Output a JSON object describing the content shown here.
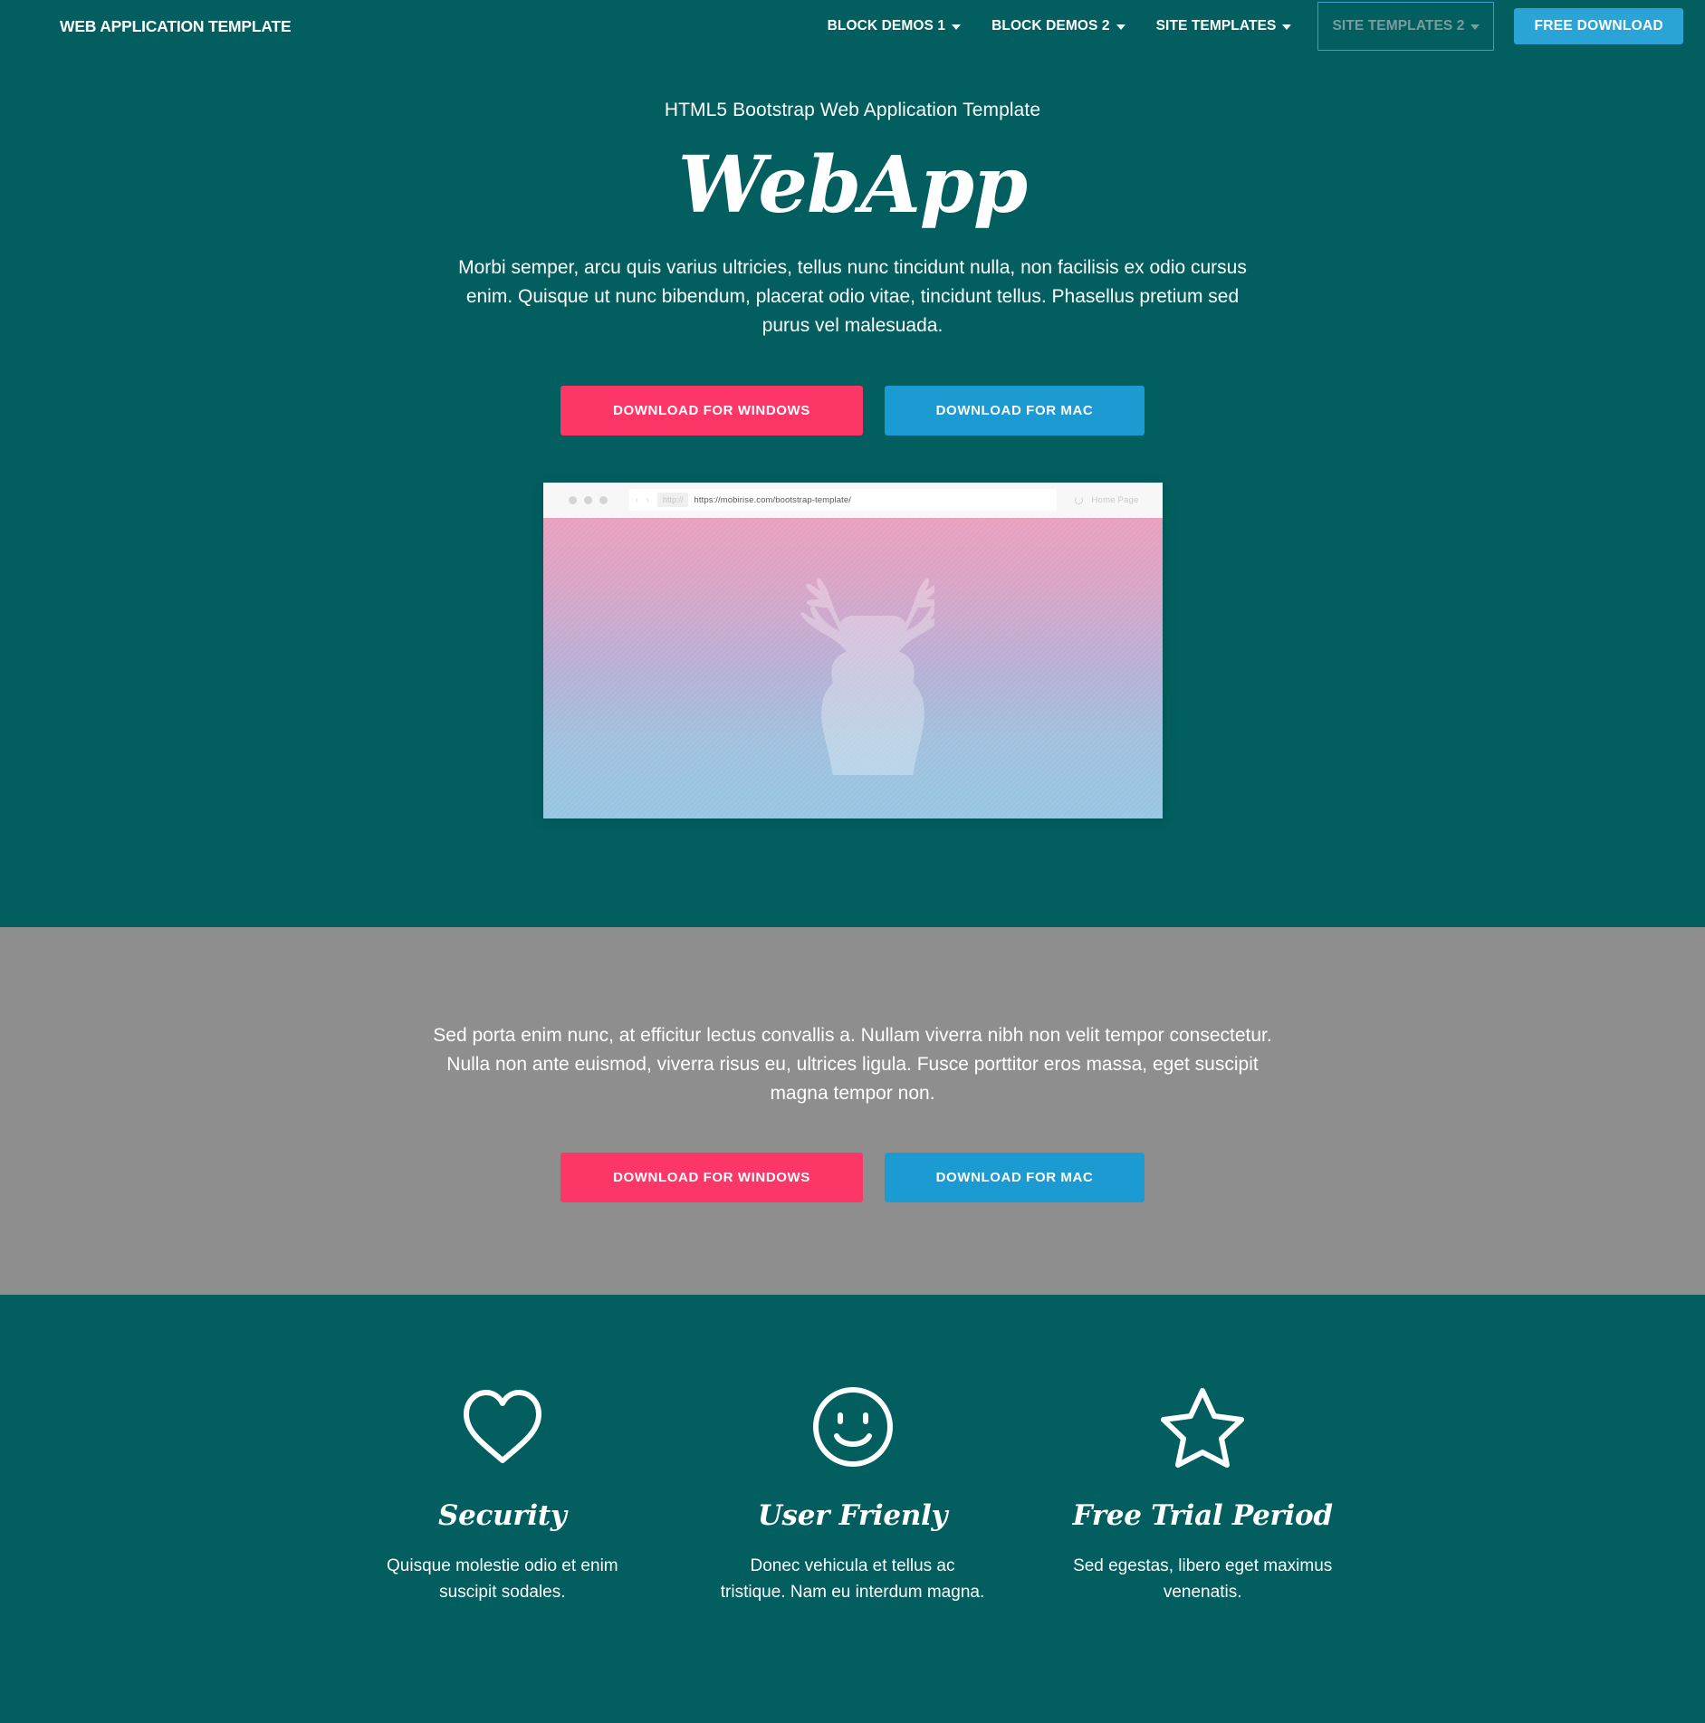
{
  "navbar": {
    "brand": "WEB APPLICATION TEMPLATE",
    "items": [
      {
        "label": "BLOCK DEMOS 1",
        "has_caret": true,
        "focused": false
      },
      {
        "label": "BLOCK DEMOS 2",
        "has_caret": true,
        "focused": false
      },
      {
        "label": "SITE TEMPLATES",
        "has_caret": true,
        "focused": false
      },
      {
        "label": "SITE TEMPLATES 2",
        "has_caret": true,
        "focused": true
      }
    ],
    "cta_label": "FREE DOWNLOAD",
    "colors": {
      "background": "#025e5f",
      "cta": "#2aa4d6",
      "focus_outline": "#3a9fd4"
    }
  },
  "hero": {
    "kicker": "HTML5 Bootstrap Web Application Template",
    "title": "WebApp",
    "paragraph": "Morbi semper, arcu quis varius ultricies, tellus nunc tincidunt nulla, non facilisis ex odio cursus enim. Quisque ut nunc bibendum, placerat odio vitae, tincidunt tellus. Phasellus pretium sed purus vel malesuada.",
    "buttons": {
      "windows": "DOWNLOAD FOR WINDOWS",
      "mac": "DOWNLOAD FOR MAC"
    },
    "colors": {
      "windows": "#fc3768",
      "mac": "#1b9bd1"
    }
  },
  "mockup": {
    "scheme_chip": "http://",
    "url": "https://mobirise.com/bootstrap-template/",
    "tab_label": "Home Page",
    "nav_arrows": "‹ ›",
    "image_subject": "deer-silhouette",
    "gradient": {
      "from": "#e8a0bd",
      "to": "#96c6e2"
    }
  },
  "gray_section": {
    "paragraph": "Sed porta enim nunc, at efficitur lectus convallis a. Nullam viverra nibh non velit tempor consectetur. Nulla non ante euismod, viverra risus eu, ultrices ligula. Fusce porttitor eros massa, eget suscipit magna tempor non.",
    "buttons": {
      "windows": "DOWNLOAD FOR WINDOWS",
      "mac": "DOWNLOAD FOR MAC"
    },
    "background": "#8e8e8e"
  },
  "features": {
    "items": [
      {
        "icon": "heart-icon",
        "title": "Security",
        "description": "Quisque molestie odio et enim suscipit sodales."
      },
      {
        "icon": "smiley-icon",
        "title": "User Frienly",
        "description": "Donec vehicula et tellus ac tristique. Nam eu interdum magna."
      },
      {
        "icon": "star-icon",
        "title": "Free Trial Period",
        "description": "Sed egestas, libero eget maximus venenatis."
      }
    ]
  }
}
